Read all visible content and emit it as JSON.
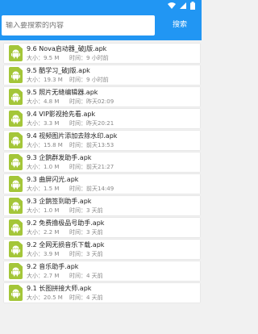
{
  "search": {
    "placeholder": "输入要搜索的内容",
    "button_label": "搜索"
  },
  "labels": {
    "size": "大小：",
    "time": "时间："
  },
  "files": [
    {
      "name": "9.6 Nova启动器_破J版.apk",
      "size": "9.5 M",
      "time": "9 小时前"
    },
    {
      "name": "9.5 酷学习_破J版.apk",
      "size": "19.3 M",
      "time": "9 小时前"
    },
    {
      "name": "9.5 照片无缝编辑器.apk",
      "size": "4.8 M",
      "time": "昨天02:09"
    },
    {
      "name": "9.4 VIP影视抢先看.apk",
      "size": "3.3 M",
      "time": "昨天20:21"
    },
    {
      "name": "9.4 视频图片添加去除水印.apk",
      "size": "15.8 M",
      "time": "前天13:53"
    },
    {
      "name": "9.3 企鹅群发助手.apk",
      "size": "1.0 M",
      "time": "前天21:27"
    },
    {
      "name": "9.3 曲屏闪光.apk",
      "size": "1.5 M",
      "time": "前天14:49"
    },
    {
      "name": "9.3 企鹅签到助手.apk",
      "size": "1.0 M",
      "time": "3 天前"
    },
    {
      "name": "9.2 免费撸极品号助手.apk",
      "size": "2.2 M",
      "time": "3 天前"
    },
    {
      "name": "9.2 全网无损音乐下载.apk",
      "size": "3.9 M",
      "time": "3 天前"
    },
    {
      "name": "9.2 音乐助手.apk",
      "size": "2.7 M",
      "time": "4 天前"
    },
    {
      "name": "9.1 长图拼接大师.apk",
      "size": "20.5 M",
      "time": "4 天前"
    }
  ]
}
